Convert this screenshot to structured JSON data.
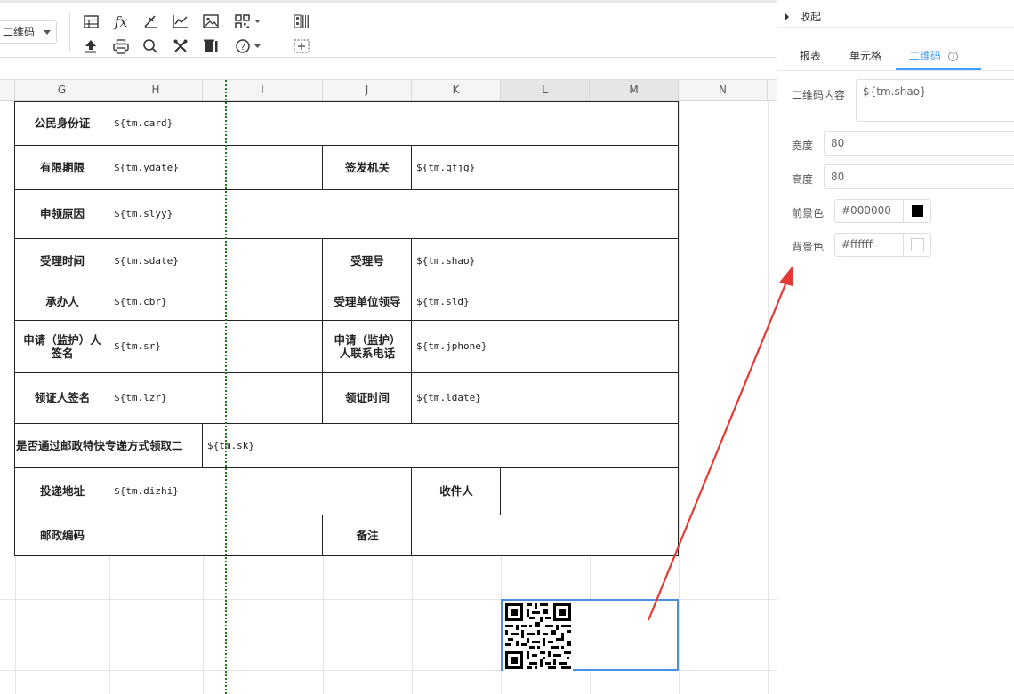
{
  "toolbar": {
    "qr_select_value": "二维码",
    "icons": [
      "table-icon",
      "formula-icon",
      "brush-icon",
      "line-chart-icon",
      "image-icon",
      "qrcode-icon",
      "upload-icon",
      "print-icon",
      "search-icon",
      "tools-icon",
      "delete-icon",
      "help-icon",
      "qr-barcode-icon",
      "merge-icon"
    ]
  },
  "columns": [
    "G",
    "H",
    "I",
    "J",
    "K",
    "L",
    "M",
    "N"
  ],
  "form": {
    "r1": {
      "label": "公民身份证",
      "value": "${tm.card}"
    },
    "r2": {
      "label": "有限期限",
      "value": "${tm.ydate}",
      "label2": "签发机关",
      "value2": "${tm.qfjg}"
    },
    "r3": {
      "label": "申领原因",
      "value": "${tm.slyy}"
    },
    "r4": {
      "label": "受理时间",
      "value": "${tm.sdate}",
      "label2": "受理号",
      "value2": "${tm.shao}"
    },
    "r5": {
      "label": "承办人",
      "value": "${tm.cbr}",
      "label2": "受理单位领导",
      "value2": "${tm.sld}"
    },
    "r6": {
      "label": "申请（监护）人\n签名",
      "value": "${tm.sr}",
      "label2": "申请（监护）\n人联系电话",
      "value2": "${tm.jphone}"
    },
    "r7": {
      "label": "领证人签名",
      "value": "${tm.lzr}",
      "label2": "领证时间",
      "value2": "${tm.ldate}"
    },
    "r8": {
      "label": "是否通过邮政特快专递方式领取二",
      "value": "${tm.sk}"
    },
    "r9": {
      "label": "投递地址",
      "value": "${tm.dizhi}",
      "label2": "收件人"
    },
    "r10": {
      "label": "邮政编码",
      "label2": "备注"
    }
  },
  "panel": {
    "collapse_label": "收起",
    "tabs": [
      "报表",
      "单元格",
      "二维码"
    ],
    "active_tab": "二维码",
    "qr_content_label": "二维码内容",
    "qr_content_value": "${tm.shao}",
    "width_label": "宽度",
    "width_value": "80",
    "height_label": "高度",
    "height_value": "80",
    "fg_label": "前景色",
    "fg_value": "#000000",
    "bg_label": "背景色",
    "bg_value": "#ffffff"
  },
  "colors": {
    "accent": "#409eff",
    "arrow": "#e53935",
    "dotted_line": "#1a7a1a"
  }
}
